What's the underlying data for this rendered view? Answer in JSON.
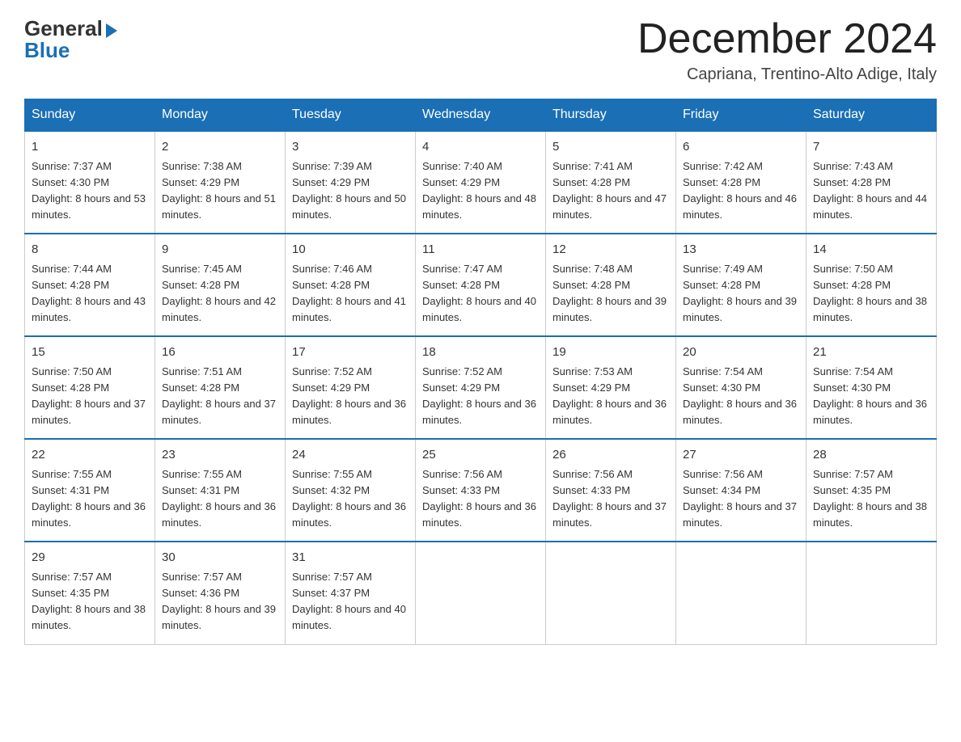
{
  "header": {
    "logo_general": "General",
    "logo_blue": "Blue",
    "month_title": "December 2024",
    "location": "Capriana, Trentino-Alto Adige, Italy"
  },
  "days_of_week": [
    "Sunday",
    "Monday",
    "Tuesday",
    "Wednesday",
    "Thursday",
    "Friday",
    "Saturday"
  ],
  "weeks": [
    [
      {
        "day": "1",
        "sunrise": "7:37 AM",
        "sunset": "4:30 PM",
        "daylight": "8 hours and 53 minutes."
      },
      {
        "day": "2",
        "sunrise": "7:38 AM",
        "sunset": "4:29 PM",
        "daylight": "8 hours and 51 minutes."
      },
      {
        "day": "3",
        "sunrise": "7:39 AM",
        "sunset": "4:29 PM",
        "daylight": "8 hours and 50 minutes."
      },
      {
        "day": "4",
        "sunrise": "7:40 AM",
        "sunset": "4:29 PM",
        "daylight": "8 hours and 48 minutes."
      },
      {
        "day": "5",
        "sunrise": "7:41 AM",
        "sunset": "4:28 PM",
        "daylight": "8 hours and 47 minutes."
      },
      {
        "day": "6",
        "sunrise": "7:42 AM",
        "sunset": "4:28 PM",
        "daylight": "8 hours and 46 minutes."
      },
      {
        "day": "7",
        "sunrise": "7:43 AM",
        "sunset": "4:28 PM",
        "daylight": "8 hours and 44 minutes."
      }
    ],
    [
      {
        "day": "8",
        "sunrise": "7:44 AM",
        "sunset": "4:28 PM",
        "daylight": "8 hours and 43 minutes."
      },
      {
        "day": "9",
        "sunrise": "7:45 AM",
        "sunset": "4:28 PM",
        "daylight": "8 hours and 42 minutes."
      },
      {
        "day": "10",
        "sunrise": "7:46 AM",
        "sunset": "4:28 PM",
        "daylight": "8 hours and 41 minutes."
      },
      {
        "day": "11",
        "sunrise": "7:47 AM",
        "sunset": "4:28 PM",
        "daylight": "8 hours and 40 minutes."
      },
      {
        "day": "12",
        "sunrise": "7:48 AM",
        "sunset": "4:28 PM",
        "daylight": "8 hours and 39 minutes."
      },
      {
        "day": "13",
        "sunrise": "7:49 AM",
        "sunset": "4:28 PM",
        "daylight": "8 hours and 39 minutes."
      },
      {
        "day": "14",
        "sunrise": "7:50 AM",
        "sunset": "4:28 PM",
        "daylight": "8 hours and 38 minutes."
      }
    ],
    [
      {
        "day": "15",
        "sunrise": "7:50 AM",
        "sunset": "4:28 PM",
        "daylight": "8 hours and 37 minutes."
      },
      {
        "day": "16",
        "sunrise": "7:51 AM",
        "sunset": "4:28 PM",
        "daylight": "8 hours and 37 minutes."
      },
      {
        "day": "17",
        "sunrise": "7:52 AM",
        "sunset": "4:29 PM",
        "daylight": "8 hours and 36 minutes."
      },
      {
        "day": "18",
        "sunrise": "7:52 AM",
        "sunset": "4:29 PM",
        "daylight": "8 hours and 36 minutes."
      },
      {
        "day": "19",
        "sunrise": "7:53 AM",
        "sunset": "4:29 PM",
        "daylight": "8 hours and 36 minutes."
      },
      {
        "day": "20",
        "sunrise": "7:54 AM",
        "sunset": "4:30 PM",
        "daylight": "8 hours and 36 minutes."
      },
      {
        "day": "21",
        "sunrise": "7:54 AM",
        "sunset": "4:30 PM",
        "daylight": "8 hours and 36 minutes."
      }
    ],
    [
      {
        "day": "22",
        "sunrise": "7:55 AM",
        "sunset": "4:31 PM",
        "daylight": "8 hours and 36 minutes."
      },
      {
        "day": "23",
        "sunrise": "7:55 AM",
        "sunset": "4:31 PM",
        "daylight": "8 hours and 36 minutes."
      },
      {
        "day": "24",
        "sunrise": "7:55 AM",
        "sunset": "4:32 PM",
        "daylight": "8 hours and 36 minutes."
      },
      {
        "day": "25",
        "sunrise": "7:56 AM",
        "sunset": "4:33 PM",
        "daylight": "8 hours and 36 minutes."
      },
      {
        "day": "26",
        "sunrise": "7:56 AM",
        "sunset": "4:33 PM",
        "daylight": "8 hours and 37 minutes."
      },
      {
        "day": "27",
        "sunrise": "7:56 AM",
        "sunset": "4:34 PM",
        "daylight": "8 hours and 37 minutes."
      },
      {
        "day": "28",
        "sunrise": "7:57 AM",
        "sunset": "4:35 PM",
        "daylight": "8 hours and 38 minutes."
      }
    ],
    [
      {
        "day": "29",
        "sunrise": "7:57 AM",
        "sunset": "4:35 PM",
        "daylight": "8 hours and 38 minutes."
      },
      {
        "day": "30",
        "sunrise": "7:57 AM",
        "sunset": "4:36 PM",
        "daylight": "8 hours and 39 minutes."
      },
      {
        "day": "31",
        "sunrise": "7:57 AM",
        "sunset": "4:37 PM",
        "daylight": "8 hours and 40 minutes."
      },
      null,
      null,
      null,
      null
    ]
  ]
}
